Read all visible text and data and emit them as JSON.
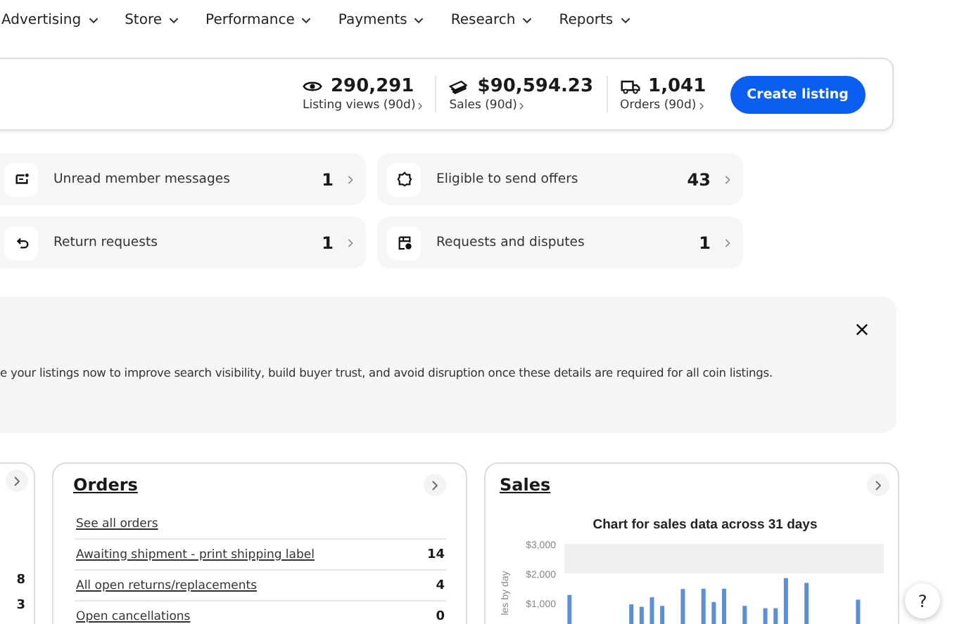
{
  "nav": [
    {
      "label": "Advertising"
    },
    {
      "label": "Store"
    },
    {
      "label": "Performance"
    },
    {
      "label": "Payments"
    },
    {
      "label": "Research"
    },
    {
      "label": "Reports"
    }
  ],
  "summary": {
    "stats": [
      {
        "kind": "views",
        "value": "290,291",
        "label": "Listing views (90d)"
      },
      {
        "kind": "sales",
        "value": "$90,594.23",
        "label": "Sales (90d)"
      },
      {
        "kind": "orders",
        "value": "1,041",
        "label": "Orders (90d)"
      }
    ],
    "button": "Create listing"
  },
  "tasks": [
    {
      "kind": "messages",
      "label": "Unread member messages",
      "count": "1"
    },
    {
      "kind": "offers",
      "label": "Eligible to send offers",
      "count": "43"
    },
    {
      "kind": "returns",
      "label": "Return requests",
      "count": "1"
    },
    {
      "kind": "disputes",
      "label": "Requests and disputes",
      "count": "1"
    }
  ],
  "banner": {
    "text": "e your listings now to improve search visibility, build buyer trust, and avoid disruption once these details are required for all coin listings."
  },
  "left_card": {
    "values": [
      "8",
      "3"
    ]
  },
  "orders": {
    "title": "Orders",
    "link": "See all orders",
    "rows": [
      {
        "label": "Awaiting shipment - print shipping label",
        "count": "14"
      },
      {
        "label": "All open returns/replacements",
        "count": "4"
      },
      {
        "label": "Open cancellations",
        "count": "0"
      }
    ]
  },
  "sales": {
    "title": "Sales",
    "chart": {
      "title": "Chart for sales data across 31 days",
      "ylabel": "les by day",
      "ytick_labels": [
        "$3,000",
        "$2,000",
        "$1,000"
      ]
    }
  },
  "help": {
    "label": "?"
  }
}
